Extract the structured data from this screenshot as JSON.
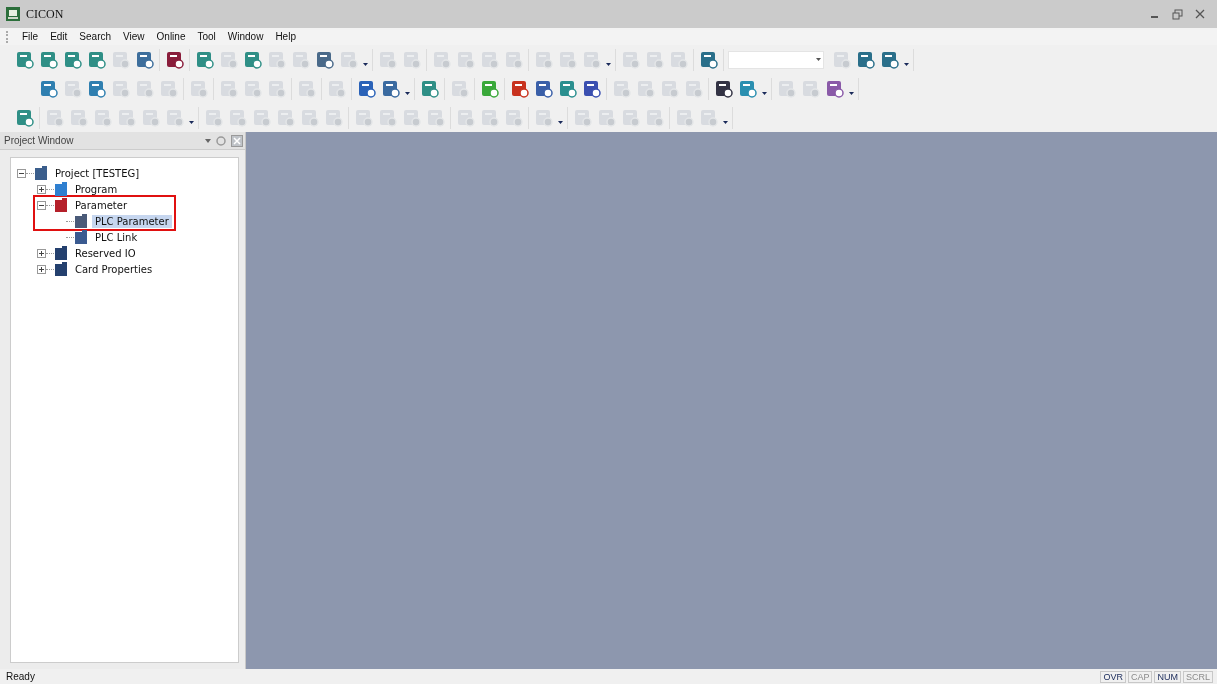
{
  "window": {
    "title": "CICON"
  },
  "menu": [
    "File",
    "Edit",
    "Search",
    "View",
    "Online",
    "Tool",
    "Window",
    "Help"
  ],
  "toolbars": [
    {
      "groups": [
        {
          "dropdown": false,
          "items": [
            {
              "kind": "icon",
              "disabled": false,
              "color": "#2f8f86"
            },
            {
              "kind": "icon",
              "disabled": false,
              "color": "#2f8f86"
            },
            {
              "kind": "icon",
              "disabled": false,
              "color": "#2f8f86"
            },
            {
              "kind": "icon",
              "disabled": false,
              "color": "#2f8f86"
            },
            {
              "kind": "icon",
              "disabled": true
            },
            {
              "kind": "icon",
              "disabled": false,
              "color": "#3d6e9c"
            }
          ]
        },
        {
          "dropdown": false,
          "items": [
            {
              "kind": "icon",
              "disabled": false,
              "color": "#8a1d3b"
            }
          ]
        },
        {
          "dropdown": true,
          "items": [
            {
              "kind": "icon",
              "disabled": false,
              "color": "#2f8f86"
            },
            {
              "kind": "icon",
              "disabled": true
            },
            {
              "kind": "icon",
              "disabled": false,
              "color": "#2f8f86"
            },
            {
              "kind": "icon",
              "disabled": true
            },
            {
              "kind": "icon",
              "disabled": true
            },
            {
              "kind": "icon",
              "disabled": false,
              "color": "#4a6a8a"
            },
            {
              "kind": "icon",
              "disabled": true
            }
          ]
        },
        {
          "dropdown": false,
          "items": [
            {
              "kind": "icon",
              "disabled": true
            },
            {
              "kind": "icon",
              "disabled": true
            }
          ]
        },
        {
          "dropdown": false,
          "items": [
            {
              "kind": "icon",
              "disabled": true
            },
            {
              "kind": "icon",
              "disabled": true
            },
            {
              "kind": "icon",
              "disabled": true
            },
            {
              "kind": "icon",
              "disabled": true
            }
          ]
        },
        {
          "dropdown": true,
          "items": [
            {
              "kind": "icon",
              "disabled": true
            },
            {
              "kind": "icon",
              "disabled": true
            },
            {
              "kind": "icon",
              "disabled": true
            }
          ]
        },
        {
          "dropdown": false,
          "items": [
            {
              "kind": "icon",
              "disabled": true
            },
            {
              "kind": "icon",
              "disabled": true
            },
            {
              "kind": "icon",
              "disabled": true
            }
          ]
        },
        {
          "dropdown": false,
          "items": [
            {
              "kind": "icon",
              "disabled": false,
              "color": "#2a6f8a"
            }
          ]
        },
        {
          "dropdown": true,
          "items": [
            {
              "kind": "combo"
            },
            {
              "kind": "icon",
              "disabled": true
            },
            {
              "kind": "icon",
              "disabled": false,
              "color": "#2a6f8a"
            },
            {
              "kind": "icon",
              "disabled": false,
              "color": "#2a6f8a"
            }
          ]
        }
      ]
    },
    {
      "groups": [
        {
          "dropdown": false,
          "items": [
            {
              "kind": "icon",
              "disabled": false,
              "color": "#2f7fb0"
            },
            {
              "kind": "icon",
              "disabled": true
            },
            {
              "kind": "icon",
              "disabled": false,
              "color": "#2f7fb0"
            },
            {
              "kind": "icon",
              "disabled": true
            },
            {
              "kind": "icon",
              "disabled": true
            },
            {
              "kind": "icon",
              "disabled": true
            }
          ]
        },
        {
          "dropdown": false,
          "items": [
            {
              "kind": "icon",
              "disabled": true
            }
          ]
        },
        {
          "dropdown": false,
          "items": [
            {
              "kind": "icon",
              "disabled": true
            },
            {
              "kind": "icon",
              "disabled": true
            },
            {
              "kind": "icon",
              "disabled": true
            }
          ]
        },
        {
          "dropdown": false,
          "items": [
            {
              "kind": "icon",
              "disabled": true
            }
          ]
        },
        {
          "dropdown": false,
          "items": [
            {
              "kind": "icon",
              "disabled": true
            }
          ]
        },
        {
          "dropdown": true,
          "items": [
            {
              "kind": "icon",
              "disabled": false,
              "color": "#2a62b8"
            },
            {
              "kind": "icon",
              "disabled": false,
              "color": "#3a6aa0"
            }
          ]
        },
        {
          "dropdown": false,
          "items": [
            {
              "kind": "icon",
              "disabled": false,
              "color": "#2f8f86"
            }
          ]
        },
        {
          "dropdown": false,
          "items": [
            {
              "kind": "icon",
              "disabled": true
            }
          ]
        },
        {
          "dropdown": false,
          "items": [
            {
              "kind": "icon",
              "disabled": false,
              "color": "#3aa83a"
            }
          ]
        },
        {
          "dropdown": false,
          "items": [
            {
              "kind": "icon",
              "disabled": false,
              "color": "#c8321e"
            },
            {
              "kind": "icon",
              "disabled": false,
              "color": "#3a5fa8"
            },
            {
              "kind": "icon",
              "disabled": false,
              "color": "#2a8f8f"
            },
            {
              "kind": "icon",
              "disabled": false,
              "color": "#3a4fb0"
            }
          ]
        },
        {
          "dropdown": false,
          "items": [
            {
              "kind": "icon",
              "disabled": true
            },
            {
              "kind": "icon",
              "disabled": true
            },
            {
              "kind": "icon",
              "disabled": true
            },
            {
              "kind": "icon",
              "disabled": true
            }
          ]
        },
        {
          "dropdown": true,
          "items": [
            {
              "kind": "icon",
              "disabled": false,
              "color": "#333344"
            },
            {
              "kind": "icon",
              "disabled": false,
              "color": "#2a8fb0"
            }
          ]
        },
        {
          "dropdown": true,
          "items": [
            {
              "kind": "icon",
              "disabled": true
            },
            {
              "kind": "icon",
              "disabled": true
            },
            {
              "kind": "icon",
              "disabled": false,
              "color": "#8a5aa8"
            }
          ]
        }
      ]
    },
    {
      "groups": [
        {
          "dropdown": false,
          "items": [
            {
              "kind": "icon",
              "disabled": false,
              "color": "#2f8f86"
            }
          ]
        },
        {
          "dropdown": true,
          "items": [
            {
              "kind": "icon",
              "disabled": true
            },
            {
              "kind": "icon",
              "disabled": true
            },
            {
              "kind": "icon",
              "disabled": true
            },
            {
              "kind": "icon",
              "disabled": true
            },
            {
              "kind": "icon",
              "disabled": true
            },
            {
              "kind": "icon",
              "disabled": true
            }
          ]
        },
        {
          "dropdown": false,
          "items": [
            {
              "kind": "icon",
              "disabled": true
            },
            {
              "kind": "icon",
              "disabled": true
            },
            {
              "kind": "icon",
              "disabled": true
            },
            {
              "kind": "icon",
              "disabled": true
            },
            {
              "kind": "icon",
              "disabled": true
            },
            {
              "kind": "icon",
              "disabled": true
            }
          ]
        },
        {
          "dropdown": false,
          "items": [
            {
              "kind": "icon",
              "disabled": true
            },
            {
              "kind": "icon",
              "disabled": true
            },
            {
              "kind": "icon",
              "disabled": true
            },
            {
              "kind": "icon",
              "disabled": true
            }
          ]
        },
        {
          "dropdown": false,
          "items": [
            {
              "kind": "icon",
              "disabled": true
            },
            {
              "kind": "icon",
              "disabled": true
            },
            {
              "kind": "icon",
              "disabled": true
            }
          ]
        },
        {
          "dropdown": true,
          "items": [
            {
              "kind": "icon",
              "disabled": true
            }
          ]
        },
        {
          "dropdown": false,
          "items": [
            {
              "kind": "icon",
              "disabled": true
            },
            {
              "kind": "icon",
              "disabled": true
            },
            {
              "kind": "icon",
              "disabled": true
            },
            {
              "kind": "icon",
              "disabled": true
            }
          ]
        },
        {
          "dropdown": true,
          "items": [
            {
              "kind": "icon",
              "disabled": true
            },
            {
              "kind": "icon",
              "disabled": true
            }
          ]
        }
      ]
    }
  ],
  "project_window": {
    "title": "Project Window",
    "tree": [
      {
        "label": "Project [TESTEG]",
        "expanded": true,
        "color": "#3b5e8c",
        "selected": false,
        "highlighted": false,
        "children": [
          {
            "label": "Program",
            "expanded": false,
            "color": "#2f7fd0",
            "selected": false,
            "highlighted": false
          },
          {
            "label": "Parameter",
            "expanded": true,
            "color": "#b5202a",
            "selected": false,
            "highlighted": true,
            "children": [
              {
                "label": "PLC Parameter",
                "color": "#4a5a78",
                "selected": true,
                "highlighted": true
              },
              {
                "label": "PLC Link",
                "color": "#3a5a90",
                "selected": false,
                "highlighted": false
              }
            ]
          },
          {
            "label": "Reserved IO",
            "expanded": false,
            "color": "#24406e",
            "selected": false,
            "highlighted": false
          },
          {
            "label": "Card Properties",
            "expanded": false,
            "color": "#24406e",
            "selected": false,
            "highlighted": false
          }
        ]
      }
    ]
  },
  "status_bar": {
    "text": "Ready",
    "indicators": [
      {
        "label": "OVR",
        "disabled": false
      },
      {
        "label": "CAP",
        "disabled": true
      },
      {
        "label": "NUM",
        "disabled": false
      },
      {
        "label": "SCRL",
        "disabled": true
      }
    ]
  }
}
